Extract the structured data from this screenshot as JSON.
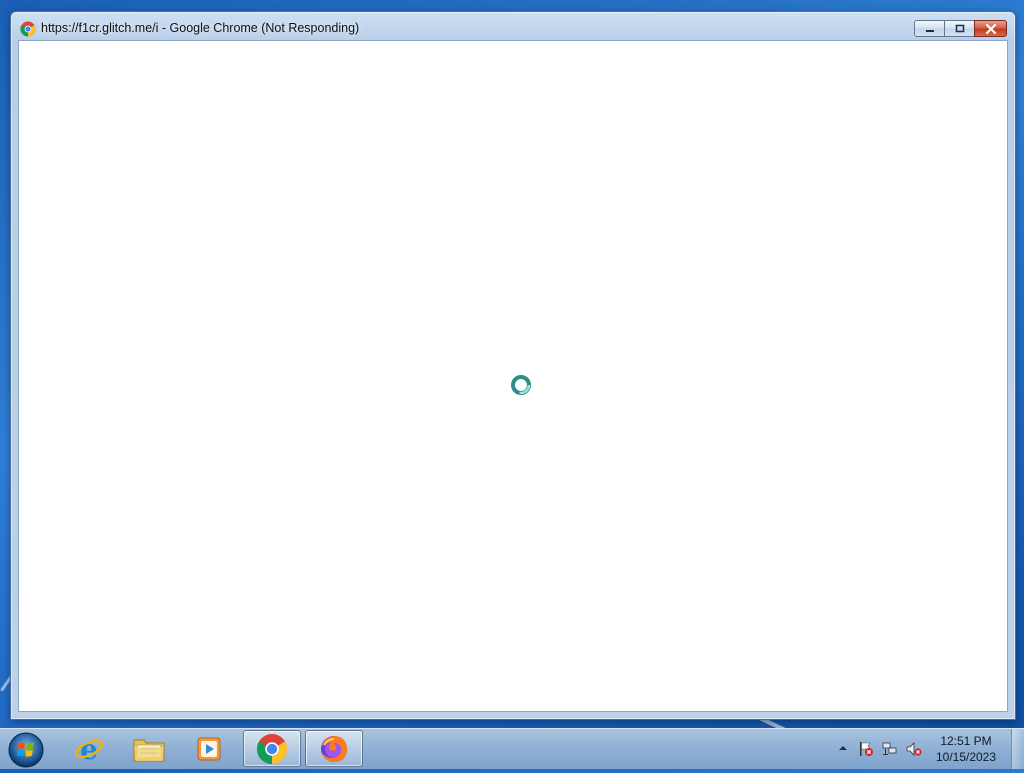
{
  "window": {
    "title": "https://f1cr.glitch.me/i - Google Chrome (Not Responding)",
    "app_icon": "chrome-icon"
  },
  "taskbar": {
    "items": [
      {
        "name": "start-button",
        "icon": "windows-start-icon"
      },
      {
        "name": "internet-explorer",
        "icon": "internet-explorer-icon"
      },
      {
        "name": "file-explorer",
        "icon": "folder-icon"
      },
      {
        "name": "media-player",
        "icon": "media-player-icon"
      },
      {
        "name": "google-chrome",
        "icon": "chrome-icon",
        "active": true
      },
      {
        "name": "firefox",
        "icon": "firefox-icon",
        "active": true
      }
    ],
    "tray_icons": [
      "show-hidden-icons-arrow",
      "action-center-flag-icon",
      "network-icon",
      "volume-muted-icon"
    ],
    "clock": {
      "time": "12:51 PM",
      "date": "10/15/2023"
    }
  },
  "colors": {
    "desktop": "#1c63c0",
    "close_button": "#c23a20"
  }
}
